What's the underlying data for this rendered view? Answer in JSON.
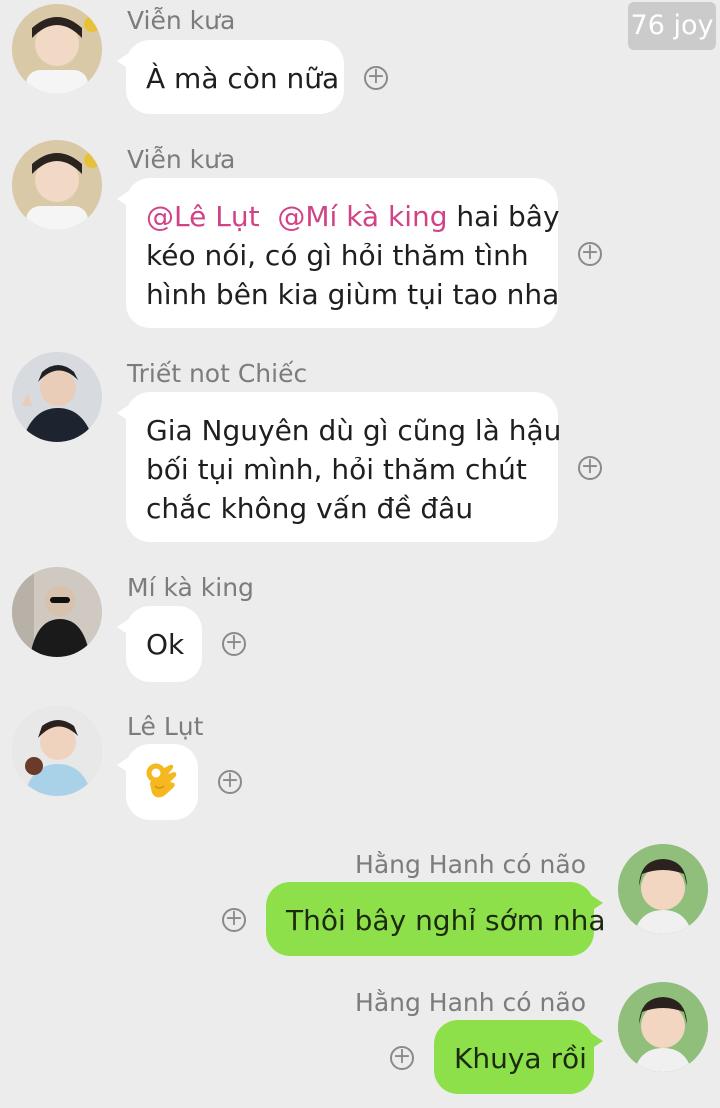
{
  "watermark": "76 joy",
  "colors": {
    "outgoing_bubble": "#8ee04a",
    "incoming_bubble": "#ffffff",
    "mention": "#d14386",
    "background": "#ececec"
  },
  "messages": [
    {
      "sender": "Viễn kưa",
      "direction": "incoming",
      "lines": [
        "À mà còn nữa"
      ]
    },
    {
      "sender": "Viễn kưa",
      "direction": "incoming",
      "mentions": [
        "@Lê Lụt",
        "@Mí kà king"
      ],
      "line1_rest": "hai bây",
      "lines": [
        "kéo nói, có gì hỏi thăm tình",
        "hình bên kia giùm tụi tao nha"
      ]
    },
    {
      "sender": "Triết not Chiếc",
      "direction": "incoming",
      "lines": [
        "Gia Nguyên dù gì cũng là hậu",
        "bối tụi mình, hỏi thăm chút",
        "chắc không vấn đề đâu"
      ]
    },
    {
      "sender": "Mí kà king",
      "direction": "incoming",
      "lines": [
        "Ok"
      ]
    },
    {
      "sender": "Lê Lụt",
      "direction": "incoming",
      "emoji": "ok-hand-emoji"
    },
    {
      "sender": "Hằng Hanh có não",
      "direction": "outgoing",
      "lines": [
        "Thôi bây nghỉ sớm nha"
      ]
    },
    {
      "sender": "Hằng Hanh có não",
      "direction": "outgoing",
      "lines": [
        "Khuya rồi"
      ]
    }
  ]
}
